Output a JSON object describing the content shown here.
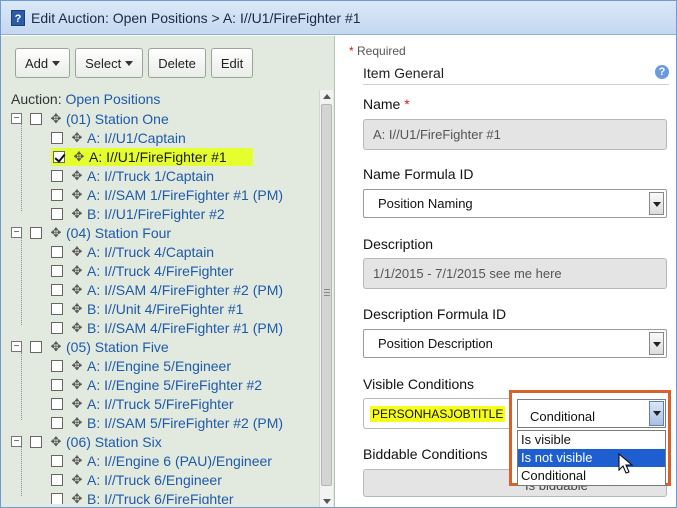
{
  "window": {
    "title_icon": "?",
    "title": "Edit Auction: Open Positions > A: I//U1/FireFighter #1"
  },
  "toolbar": {
    "add_label": "Add",
    "select_label": "Select",
    "delete_label": "Delete",
    "edit_label": "Edit"
  },
  "tree": {
    "root_prefix": "Auction:",
    "root_name": "Open Positions",
    "groups": [
      {
        "label": "(01) Station One",
        "children": [
          {
            "label": "A: I//U1/Captain",
            "checked": false
          },
          {
            "label": "A: I//U1/FireFighter #1",
            "checked": true
          },
          {
            "label": "A: I//Truck 1/Captain",
            "checked": false
          },
          {
            "label": "A: I//SAM 1/FireFighter #1 (PM)",
            "checked": false
          },
          {
            "label": "B: I//U1/FireFighter #2",
            "checked": false
          }
        ]
      },
      {
        "label": "(04) Station Four",
        "children": [
          {
            "label": "A: I//Truck 4/Captain",
            "checked": false
          },
          {
            "label": "A: I//Truck 4/FireFighter",
            "checked": false
          },
          {
            "label": "A: I//SAM 4/FireFighter #2 (PM)",
            "checked": false
          },
          {
            "label": "B: I//Unit 4/FireFighter #1",
            "checked": false
          },
          {
            "label": "B: I//SAM 4/FireFighter #1 (PM)",
            "checked": false
          }
        ]
      },
      {
        "label": "(05) Station Five",
        "children": [
          {
            "label": "A: I//Engine 5/Engineer",
            "checked": false
          },
          {
            "label": "A: I//Engine 5/FireFighter #2",
            "checked": false
          },
          {
            "label": "A: I//Truck 5/FireFighter",
            "checked": false
          },
          {
            "label": "B: I//SAM 5/FireFighter #2 (PM)",
            "checked": false
          }
        ]
      },
      {
        "label": "(06) Station Six",
        "children": [
          {
            "label": "A: I//Engine 6 (PAU)/Engineer",
            "checked": false
          },
          {
            "label": "A: I//Truck 6/Engineer",
            "checked": false
          },
          {
            "label": "B: I//Truck 6/FireFighter",
            "checked": false
          }
        ]
      }
    ]
  },
  "form": {
    "required_note": "Required",
    "section_title": "Item General",
    "name_label": "Name",
    "name_value": "A: I//U1/FireFighter #1",
    "name_formula_label": "Name Formula ID",
    "name_formula_value": "Position Naming",
    "description_label": "Description",
    "description_value": "1/1/2015 - 7/1/2015 see me here",
    "description_formula_label": "Description Formula ID",
    "description_formula_value": "Position Description",
    "visible_conditions_label": "Visible Conditions",
    "visible_formula_text": "PERSONHASJOBTITLE",
    "visible_select_value": "Conditional",
    "visible_options": [
      "Is visible",
      "Is not visible",
      "Conditional"
    ],
    "visible_highlighted_option": "Is not visible",
    "biddable_conditions_label": "Biddable Conditions",
    "biddable_select_value": "Is biddable"
  },
  "colors": {
    "highlight": "#e4ff2d",
    "link": "#1f5aa8",
    "dropdown_frame": "#d9622b",
    "selected_option": "#1d5fd1"
  }
}
